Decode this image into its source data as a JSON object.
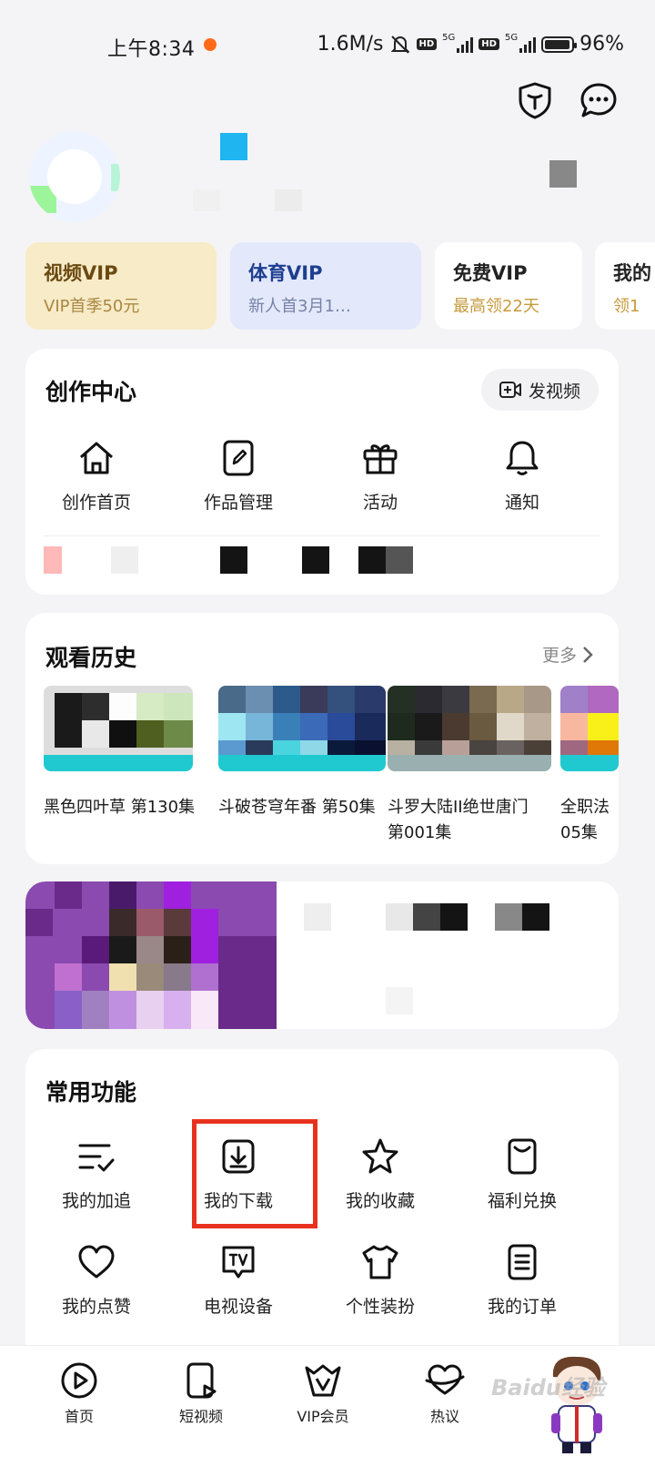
{
  "status_bar": {
    "time": "上午8:34",
    "speed": "1.6M/s",
    "hd1": "HD",
    "net1": "5G",
    "hd2": "HD",
    "net2": "5G",
    "battery": "96%",
    "battery_level": 0.96
  },
  "vip_cards": [
    {
      "title": "视频VIP",
      "subtitle": "VIP首季50元",
      "bg": "#f7ebc8",
      "title_color": "#6b4a12",
      "sub_color": "#a98740"
    },
    {
      "title": "体育VIP",
      "subtitle": "新人首3月1…",
      "bg": "#e3e8fb",
      "title_color": "#1e3e8f",
      "sub_color": "#7683a8"
    },
    {
      "title": "免费VIP",
      "subtitle": "最高领22天",
      "bg": "#ffffff",
      "title_color": "#222222",
      "sub_color": "#c79a3c"
    },
    {
      "title": "我的",
      "subtitle": "领1",
      "bg": "#ffffff",
      "title_color": "#222222",
      "sub_color": "#c79a3c"
    }
  ],
  "creator_center": {
    "title": "创作中心",
    "post_button": "发视频",
    "items": [
      {
        "label": "创作首页",
        "icon": "home-icon"
      },
      {
        "label": "作品管理",
        "icon": "edit-icon"
      },
      {
        "label": "活动",
        "icon": "gift-icon"
      },
      {
        "label": "通知",
        "icon": "bell-icon"
      }
    ]
  },
  "watch_history": {
    "title": "观看历史",
    "more": "更多",
    "items": [
      {
        "title": "黑色四叶草 第130集"
      },
      {
        "title": "斗破苍穹年番 第50集"
      },
      {
        "title": "斗罗大陆II绝世唐门 第001集"
      },
      {
        "title": "全职法 05集"
      }
    ]
  },
  "common_functions": {
    "title": "常用功能",
    "items": [
      {
        "label": "我的加追",
        "icon": "follow-list-icon"
      },
      {
        "label": "我的下载",
        "icon": "download-icon"
      },
      {
        "label": "我的收藏",
        "icon": "star-icon"
      },
      {
        "label": "福利兑换",
        "icon": "coupon-icon"
      },
      {
        "label": "我的点赞",
        "icon": "heart-icon"
      },
      {
        "label": "电视设备",
        "icon": "tv-icon"
      },
      {
        "label": "个性装扮",
        "icon": "tshirt-icon"
      },
      {
        "label": "我的订单",
        "icon": "order-icon"
      }
    ]
  },
  "bottom_nav": [
    {
      "label": "首页",
      "icon": "play-icon"
    },
    {
      "label": "短视频",
      "icon": "short-video-icon"
    },
    {
      "label": "VIP会员",
      "icon": "vip-crown-icon"
    },
    {
      "label": "热议",
      "icon": "discussion-icon"
    }
  ],
  "watermark": "Baidu经验",
  "accent_colors": {
    "highlight": "#e8321e",
    "teal_band": "#20c9cf"
  }
}
